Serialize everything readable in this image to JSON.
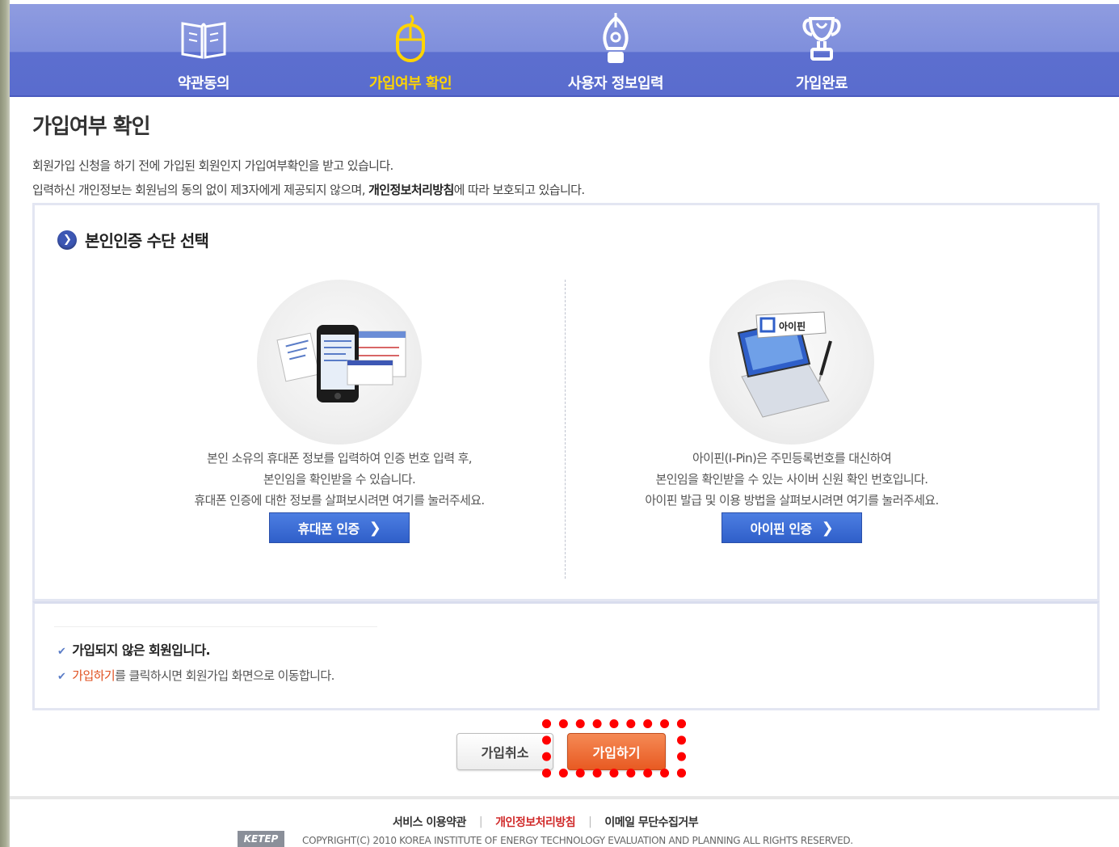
{
  "steps": [
    {
      "label": "약관동의",
      "icon": "book-icon"
    },
    {
      "label": "가입여부 확인",
      "icon": "mouse-icon",
      "active": true
    },
    {
      "label": "사용자 정보입력",
      "icon": "pen-nib-icon"
    },
    {
      "label": "가입완료",
      "icon": "trophy-icon"
    }
  ],
  "page": {
    "title": "가입여부 확인",
    "intro1": "회원가입 신청을 하기 전에 가입된 회원인지 가입여부확인을 받고 있습니다.",
    "intro2_prefix": "입력하신 개인정보는 회원님의 동의 없이 제3자에게 제공되지 않으며, ",
    "intro2_bold": "개인정보처리방침",
    "intro2_suffix": "에 따라 보호되고 있습니다."
  },
  "auth": {
    "section_title": "본인인증 수단 선택",
    "phone": {
      "desc1": "본인 소유의 휴대폰 정보를 입력하여 인증 번호 입력 후,",
      "desc2": "본인임을 확인받을 수 있습니다.",
      "desc3": "휴대폰 인증에 대한 정보를 살펴보시려면 여기를 눌러주세요.",
      "button": "휴대폰 인증"
    },
    "ipin": {
      "image_text": "아이핀",
      "desc1": "아이핀(I-Pin)은 주민등록번호를 대신하여",
      "desc2": "본인임을 확인받을 수 있는 사이버 신원 확인 번호입니다.",
      "desc3": "아이핀 발급 및 이용 방법을 살펴보시려면 여기를 눌러주세요.",
      "button": "아이핀 인증"
    }
  },
  "notice": {
    "line1": "가입되지 않은 회원입니다.",
    "line2_link": "가입하기",
    "line2_suffix": "를 클릭하시면 회원가입 화면으로 이동합니다."
  },
  "buttons": {
    "cancel": "가입취소",
    "join": "가입하기"
  },
  "footer": {
    "links": [
      "서비스 이용약관",
      "개인정보처리방침",
      "이메일 무단수집거부"
    ],
    "logo": "KETEP",
    "copyright": "COPYRIGHT(C) 2010 KOREA INSTITUTE OF ENERGY TECHNOLOGY EVALUATION AND PLANNING ALL RIGHTS RESERVED."
  },
  "colors": {
    "stepbar": "#7f8fdc",
    "active_step": "#ffd400",
    "auth_button": "#2f5fc9",
    "join_button": "#e85a22",
    "highlight": "#ff0000"
  }
}
